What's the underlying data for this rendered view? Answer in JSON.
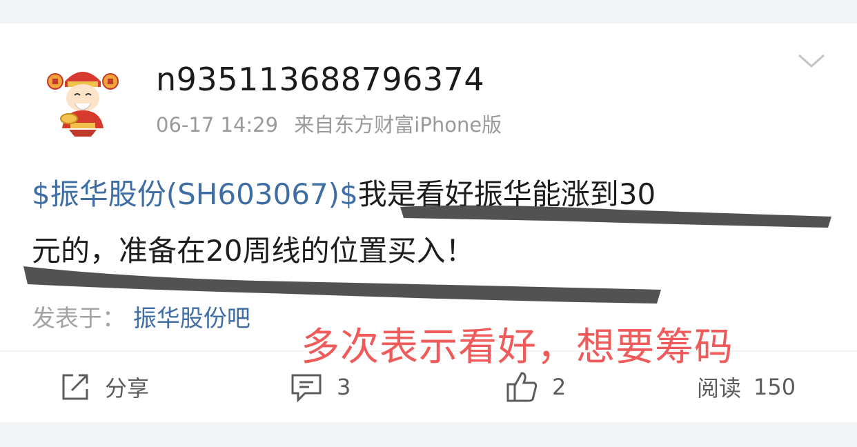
{
  "post": {
    "username": "n935113688796374",
    "time": "06-17 14:29",
    "source": "来自东方财富iPhone版",
    "stock_link": "$振华股份(SH603067)$",
    "content_line1": "我是看好振华能涨到30",
    "content_line2": "元的，准备在20周线的位置买入！",
    "posted_in_label": "发表于：",
    "forum": "振华股份吧"
  },
  "annotation": "多次表示看好，想要筹码",
  "actions": {
    "share_label": "分享",
    "comment_count": "3",
    "like_count": "2",
    "read_label": "阅读",
    "read_count": "150"
  },
  "colors": {
    "link": "#3f6ea5",
    "annotation": "#ef5a5a",
    "scribble": "#3a3a3a"
  },
  "icons": [
    "avatar-caishen",
    "chevron-down-icon",
    "share-icon",
    "comment-icon",
    "like-icon"
  ]
}
